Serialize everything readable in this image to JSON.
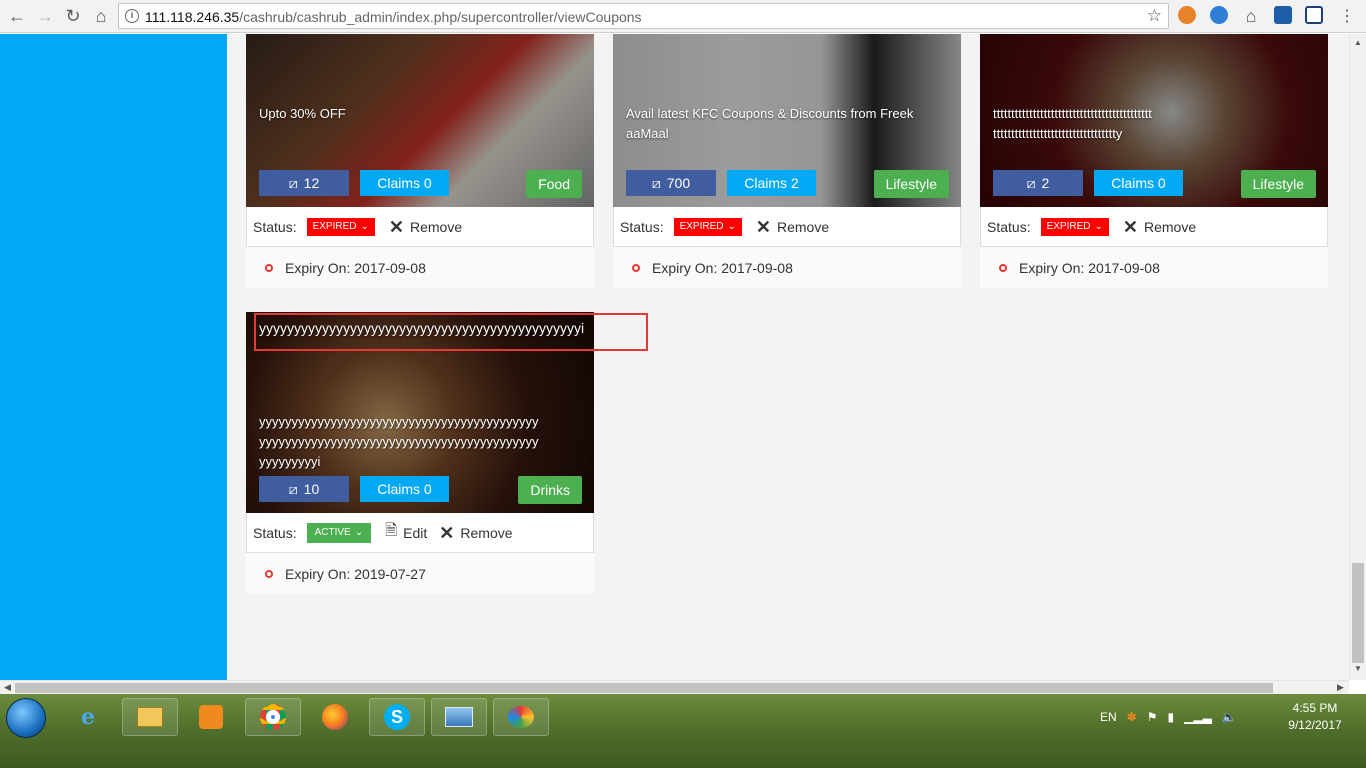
{
  "browser": {
    "url_host": "111.118.246.35",
    "url_path": "/cashrub/cashrub_admin/index.php/supercontroller/viewCoupons"
  },
  "coupons": [
    {
      "title": "Upto 30% OFF",
      "count": "12",
      "claims": "Claims 0",
      "category": "Food",
      "status_label": "Status:",
      "status": "EXPIRED",
      "remove": "Remove",
      "expiry": "Expiry On: 2017-09-08"
    },
    {
      "title": "Avail latest KFC Coupons & Discounts from FreekaaMaal",
      "count": "700",
      "claims": "Claims 2",
      "category": "Lifestyle",
      "status_label": "Status:",
      "status": "EXPIRED",
      "remove": "Remove",
      "expiry": "Expiry On: 2017-09-08"
    },
    {
      "title": "tttttttttttttttttttttttttttttttttttttttttttttttttttttttttttttttttttttttttttttty",
      "count": "2",
      "claims": "Claims 0",
      "category": "Lifestyle",
      "status_label": "Status:",
      "status": "EXPIRED",
      "remove": "Remove",
      "expiry": "Expiry On: 2017-09-08"
    },
    {
      "top_title": "yyyyyyyyyyyyyyyyyyyyyyyyyyyyyyyyyyyyyyyyyyyyyyi",
      "title": "yyyyyyyyyyyyyyyyyyyyyyyyyyyyyyyyyyyyyyyyyyyyyyyyyyyyyyyyyyyyyyyyyyyyyyyyyyyyyyyyyyyyyyyyyyyyyyyi",
      "count": "10",
      "claims": "Claims 0",
      "category": "Drinks",
      "status_label": "Status:",
      "status": "ACTIVE",
      "edit": "Edit",
      "remove": "Remove",
      "expiry": "Expiry On: 2019-07-27"
    }
  ],
  "taskbar": {
    "lang": "EN",
    "time": "4:55 PM",
    "date": "9/12/2017"
  },
  "colors": {
    "sidebar": "#03a9f4",
    "tag_button": "#3f5d9f",
    "claims_button": "#03a9f4",
    "category_button": "#4caf50",
    "expired": "#ff0000",
    "active": "#4caf50",
    "highlight": "#e53935"
  },
  "icons": [
    "back-icon",
    "forward-icon",
    "reload-icon",
    "home-icon",
    "info-icon",
    "star-icon",
    "tag-icon",
    "close-icon",
    "edit-icon",
    "chevron-down-icon",
    "bullet-icon"
  ]
}
